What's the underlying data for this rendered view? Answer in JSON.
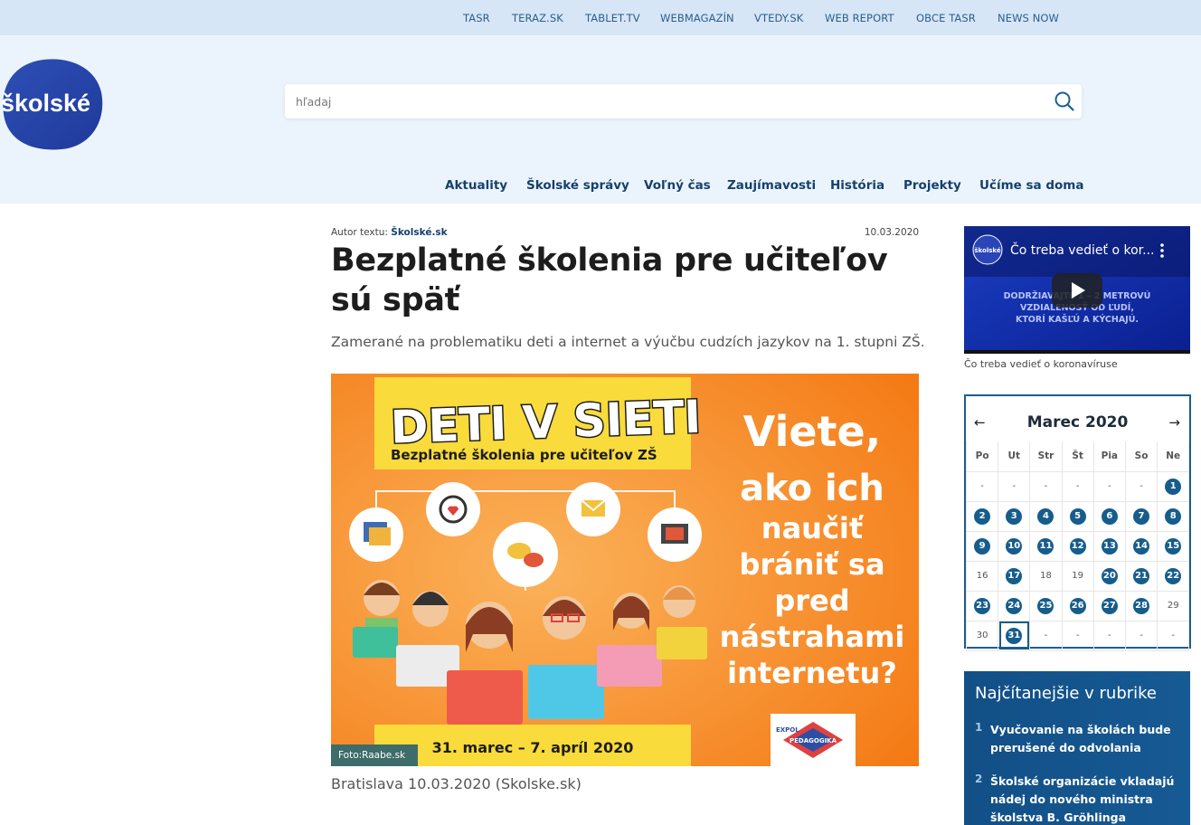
{
  "topbar": {
    "links": [
      "TASR",
      "TERAZ.SK",
      "TABLET.TV",
      "WEBMAGAZÍN",
      "VTEDY.SK",
      "WEB REPORT",
      "OBCE TASR",
      "NEWS NOW"
    ]
  },
  "header": {
    "logo_text": "školské",
    "search_placeholder": "hľadaj"
  },
  "nav": {
    "items": [
      "Aktuality",
      "Školské správy",
      "Voľný čas",
      "Zaujímavosti",
      "História",
      "Projekty",
      "Učíme sa doma"
    ]
  },
  "article": {
    "author_label": "Autor textu:",
    "author": "Školské.sk",
    "date": "10.03.2020",
    "title": "Bezplatné školenia pre učiteľov sú späť",
    "perex": "Zamerané na problematiku deti a internet a výučbu cudzích jazykov na 1. stupni ZŠ.",
    "photo_credit": "Foto:Raabe.sk",
    "caption": "Bratislava 10.03.2020 (Skolske.sk)",
    "hero": {
      "heading": "DETI V SIETI",
      "subheading": "Bezplatné školenia pre učiteľov ZŠ",
      "question_lines": [
        "Viete,",
        "ako ich",
        "naučiť",
        "brániť sa",
        "pred",
        "nástrahami",
        "internetu?"
      ],
      "dates": "31. marec – 7. apríl 2020",
      "badge_top": "EXPOL",
      "badge_bottom": "PEDAGOGIKA",
      "bg_color": "#f7871f",
      "banner_color": "#f7dc3a"
    }
  },
  "sidebar": {
    "video": {
      "channel": "školské",
      "title": "Čo treba vedieť o kor...",
      "overlay_lines": [
        "DODRŽIAVAJTE 1 – 2 METROVÚ",
        "VZDIALENOSŤ OD ĽUDÍ,",
        "KTORÍ KAŠĽÚ A KÝCHAJÚ."
      ],
      "caption": "Čo treba vedieť o koronavíruse"
    },
    "calendar": {
      "month": "Marec 2020",
      "prev": "←",
      "next": "→",
      "weekdays": [
        "Po",
        "Ut",
        "Str",
        "Št",
        "Pia",
        "So",
        "Ne"
      ],
      "weeks": [
        [
          {
            "t": "-"
          },
          {
            "t": "-"
          },
          {
            "t": "-"
          },
          {
            "t": "-"
          },
          {
            "t": "-"
          },
          {
            "t": "-"
          },
          {
            "t": "1",
            "a": true
          }
        ],
        [
          {
            "t": "2",
            "a": true
          },
          {
            "t": "3",
            "a": true
          },
          {
            "t": "4",
            "a": true
          },
          {
            "t": "5",
            "a": true
          },
          {
            "t": "6",
            "a": true
          },
          {
            "t": "7",
            "a": true
          },
          {
            "t": "8",
            "a": true
          }
        ],
        [
          {
            "t": "9",
            "a": true
          },
          {
            "t": "10",
            "a": true
          },
          {
            "t": "11",
            "a": true
          },
          {
            "t": "12",
            "a": true
          },
          {
            "t": "13",
            "a": true
          },
          {
            "t": "14",
            "a": true
          },
          {
            "t": "15",
            "a": true
          }
        ],
        [
          {
            "t": "16"
          },
          {
            "t": "17",
            "a": true
          },
          {
            "t": "18"
          },
          {
            "t": "19"
          },
          {
            "t": "20",
            "a": true
          },
          {
            "t": "21",
            "a": true
          },
          {
            "t": "22",
            "a": true
          }
        ],
        [
          {
            "t": "23",
            "a": true
          },
          {
            "t": "24",
            "a": true
          },
          {
            "t": "25",
            "a": true
          },
          {
            "t": "26",
            "a": true
          },
          {
            "t": "27",
            "a": true
          },
          {
            "t": "28",
            "a": true
          },
          {
            "t": "29"
          }
        ],
        [
          {
            "t": "30"
          },
          {
            "t": "31",
            "a": true,
            "today": true
          },
          {
            "t": "-"
          },
          {
            "t": "-"
          },
          {
            "t": "-"
          },
          {
            "t": "-"
          },
          {
            "t": "-"
          }
        ]
      ]
    },
    "most_read": {
      "title": "Najčítanejšie v rubrike",
      "items": [
        {
          "num": "1",
          "text": "Vyučovanie na školách bude prerušené do odvolania"
        },
        {
          "num": "2",
          "text": "Školské organizácie vkladajú nádej do nového ministra školstva B. Gröhlinga"
        }
      ]
    }
  }
}
